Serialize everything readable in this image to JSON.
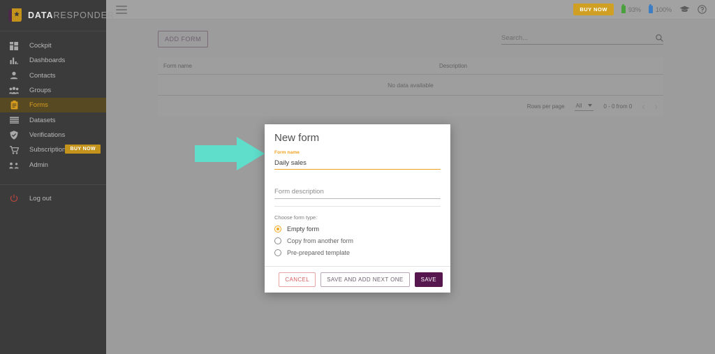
{
  "brand": {
    "bold": "DATA",
    "light": "RESPONDER",
    "logo_icon": "head-star-logo"
  },
  "sidebar": {
    "items": [
      {
        "label": "Cockpit",
        "icon": "grid-dashboard-icon"
      },
      {
        "label": "Dashboards",
        "icon": "bar-chart-icon"
      },
      {
        "label": "Contacts",
        "icon": "person-icon"
      },
      {
        "label": "Groups",
        "icon": "people-group-icon"
      },
      {
        "label": "Forms",
        "icon": "clipboard-icon",
        "active": true
      },
      {
        "label": "Datasets",
        "icon": "list-rows-icon"
      },
      {
        "label": "Verifications",
        "icon": "shield-check-icon"
      },
      {
        "label": "Subscription",
        "icon": "cart-icon",
        "badge": "BUY NOW"
      },
      {
        "label": "Admin",
        "icon": "admin-people-icon"
      }
    ],
    "logout": {
      "label": "Log out",
      "icon": "power-icon"
    }
  },
  "topbar": {
    "menu_icon": "hamburger-icon",
    "buy_now": "BUY NOW",
    "meter_green": "93%",
    "meter_blue": "100%",
    "graduation_icon": "graduation-cap-icon",
    "help_icon": "help-circle-icon"
  },
  "toolbar": {
    "add_form": "ADD FORM",
    "search_placeholder": "Search...",
    "search_value": "",
    "search_icon": "search-icon"
  },
  "table": {
    "columns": [
      "Form name",
      "Description"
    ],
    "rows": [],
    "empty_text": "No data available",
    "footer": {
      "rows_per_page_label": "Rows per page",
      "rows_per_page_value": "All",
      "range_text": "0 - 0 from 0",
      "prev_icon": "chevron-left-icon",
      "next_icon": "chevron-right-icon"
    }
  },
  "annotation": {
    "arrow_icon": "arrow-right-annotation",
    "color": "#5fdecb"
  },
  "modal": {
    "title": "New form",
    "form_name": {
      "label": "Form name",
      "value": "Daily sales"
    },
    "form_description": {
      "placeholder": "Form description",
      "value": ""
    },
    "choose_type_label": "Choose form type:",
    "options": [
      {
        "label": "Empty form",
        "selected": true
      },
      {
        "label": "Copy from another form",
        "selected": false
      },
      {
        "label": "Pre-prepared template",
        "selected": false
      }
    ],
    "buttons": {
      "cancel": "CANCEL",
      "save_next": "SAVE AND ADD NEXT ONE",
      "save": "SAVE"
    }
  },
  "colors": {
    "accent_orange": "#f0a020",
    "brand_gold": "#c4931c",
    "sidebar_bg": "#3b3b3b",
    "save_purple": "#55174d",
    "arrow_teal": "#5fdecb"
  }
}
